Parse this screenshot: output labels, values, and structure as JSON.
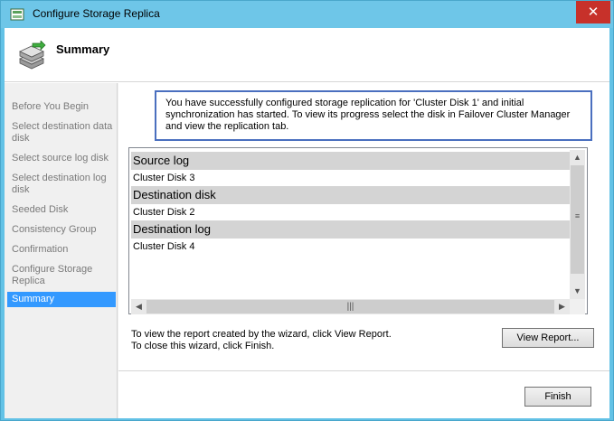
{
  "window": {
    "title": "Configure Storage Replica",
    "close_label": "✕"
  },
  "header": {
    "title": "Summary"
  },
  "nav": {
    "items": [
      {
        "label": "Before You Begin",
        "active": false
      },
      {
        "label": "Select destination data disk",
        "active": false
      },
      {
        "label": "Select source log disk",
        "active": false
      },
      {
        "label": "Select destination log disk",
        "active": false
      },
      {
        "label": "Seeded Disk",
        "active": false
      },
      {
        "label": "Consistency Group",
        "active": false
      },
      {
        "label": "Confirmation",
        "active": false
      },
      {
        "label": "Configure Storage Replica",
        "active": false
      },
      {
        "label": "Summary",
        "active": true
      }
    ]
  },
  "info": {
    "message": "You have successfully configured storage replication for 'Cluster Disk 1' and initial synchronization has started. To view its progress select the disk in Failover Cluster Manager and view the replication tab."
  },
  "list": {
    "groups": [
      {
        "header": "Source log",
        "value": "Cluster Disk 3"
      },
      {
        "header": "Destination disk",
        "value": "Cluster Disk 2"
      },
      {
        "header": "Destination log",
        "value": "Cluster Disk 4"
      }
    ]
  },
  "footer": {
    "report_line1": "To view the report created by the wizard, click View Report.",
    "report_line2": "To close this wizard, click Finish.",
    "view_report_label": "View Report...",
    "finish_label": "Finish"
  },
  "colors": {
    "title_bar": "#6ec6e8",
    "close_button": "#c7312a",
    "active_nav": "#3399ff",
    "info_border": "#4a6fbf"
  }
}
